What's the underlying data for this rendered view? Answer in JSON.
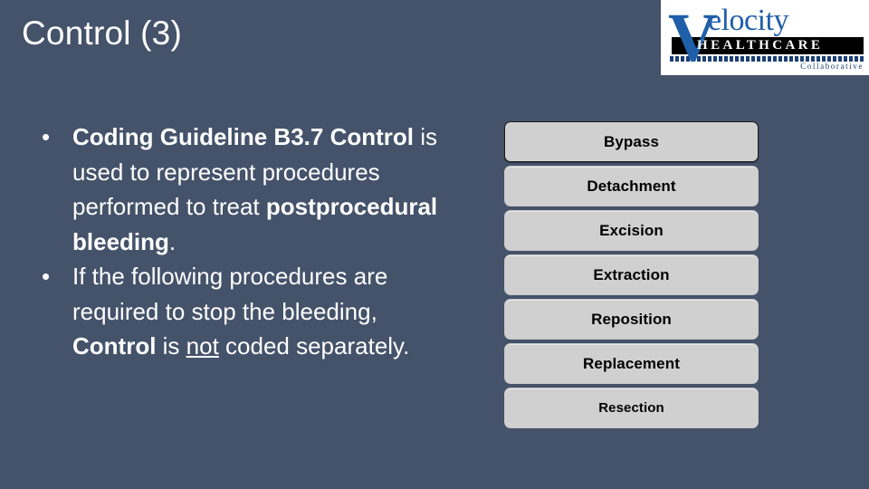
{
  "slide": {
    "title": "Control (3)",
    "background_color": "#44526a",
    "text_color": "#ffffff"
  },
  "logo": {
    "brand_letter": "V",
    "brand_name": "elocity",
    "brand_sub": "HEALTHCARE",
    "brand_tagline": "Collaborative",
    "brand_blue": "#1f5fa9",
    "bar_color": "#000000"
  },
  "content": {
    "bullets": [
      {
        "marker": "•",
        "segments": [
          {
            "text": "Coding Guideline B3.7 Control",
            "bold": true
          },
          {
            "text": " is used to represent procedures performed to treat ",
            "bold": false
          },
          {
            "text": "postprocedural bleeding",
            "bold": true
          },
          {
            "text": ".",
            "bold": false
          }
        ]
      },
      {
        "marker": "•",
        "segments": [
          {
            "text": "If the following procedures are required to stop the bleeding, ",
            "bold": false
          },
          {
            "text": "Control",
            "bold": true
          },
          {
            "text": " is ",
            "bold": false
          },
          {
            "text": "not",
            "bold": false,
            "underline": true
          },
          {
            "text": " coded separately.",
            "bold": false
          }
        ]
      }
    ]
  },
  "procedures": {
    "button_fill": "#d0d0d0",
    "items": [
      {
        "label": "Bypass",
        "selected": true,
        "small": false
      },
      {
        "label": "Detachment",
        "selected": false,
        "small": false
      },
      {
        "label": "Excision",
        "selected": false,
        "small": false
      },
      {
        "label": "Extraction",
        "selected": false,
        "small": false
      },
      {
        "label": "Reposition",
        "selected": false,
        "small": false
      },
      {
        "label": "Replacement",
        "selected": false,
        "small": false
      },
      {
        "label": "Resection",
        "selected": false,
        "small": true
      }
    ]
  }
}
